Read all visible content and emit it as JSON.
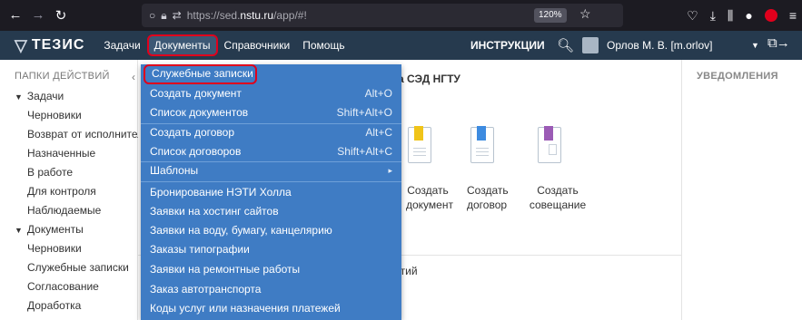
{
  "browser": {
    "url_path_prefix": "https://sed.",
    "url_host": "nstu.ru",
    "url_path_suffix": "/app/#!",
    "zoom": "120%"
  },
  "header": {
    "logo": "ТЕЗИС",
    "menu": [
      "Задачи",
      "Документы",
      "Справочники",
      "Помощь"
    ],
    "instructions": "ИНСТРУКЦИИ",
    "user": "Орлов М. В. [m.orlov]"
  },
  "left_panel": {
    "title": "ПАПКИ ДЕЙСТВИЙ",
    "groups": [
      {
        "label": "Задачи",
        "children": [
          "Черновики",
          "Возврат от исполнителя",
          "Назначенные",
          "В работе",
          "Для контроля",
          "Наблюдаемые"
        ]
      },
      {
        "label": "Документы",
        "children": [
          "Черновики",
          "Служебные записки",
          "Согласование",
          "Доработка"
        ]
      }
    ]
  },
  "center": {
    "welcome": "а СЭД НГТУ",
    "tiles": [
      {
        "line1": "Создать",
        "line2": "документ",
        "color": "#f0c419"
      },
      {
        "line1": "Создать",
        "line2": "договор",
        "color": "#3d8be0"
      },
      {
        "line1": "Создать",
        "line2": "совещание",
        "color": "#9b5bb5"
      }
    ],
    "events": "ытий"
  },
  "notifications": {
    "title": "УВЕДОМЛЕНИЯ"
  },
  "dropdown": {
    "items": [
      {
        "label": "Служебные записки",
        "shortcut": ""
      },
      {
        "label": "Создать документ",
        "shortcut": "Alt+O"
      },
      {
        "label": "Список документов",
        "shortcut": "Shift+Alt+O"
      },
      {
        "label": "Создать договор",
        "shortcut": "Alt+C"
      },
      {
        "label": "Список договоров",
        "shortcut": "Shift+Alt+C"
      },
      {
        "label": "Шаблоны",
        "shortcut": "▸"
      },
      {
        "label": "Бронирование НЭТИ Холла",
        "shortcut": ""
      },
      {
        "label": "Заявки на хостинг сайтов",
        "shortcut": ""
      },
      {
        "label": "Заявки на воду, бумагу, канцелярию",
        "shortcut": ""
      },
      {
        "label": "Заказы типографии",
        "shortcut": ""
      },
      {
        "label": "Заявки на ремонтные работы",
        "shortcut": ""
      },
      {
        "label": "Заказ автотранспорта",
        "shortcut": ""
      },
      {
        "label": "Коды услуг или назначения платежей",
        "shortcut": ""
      }
    ]
  }
}
